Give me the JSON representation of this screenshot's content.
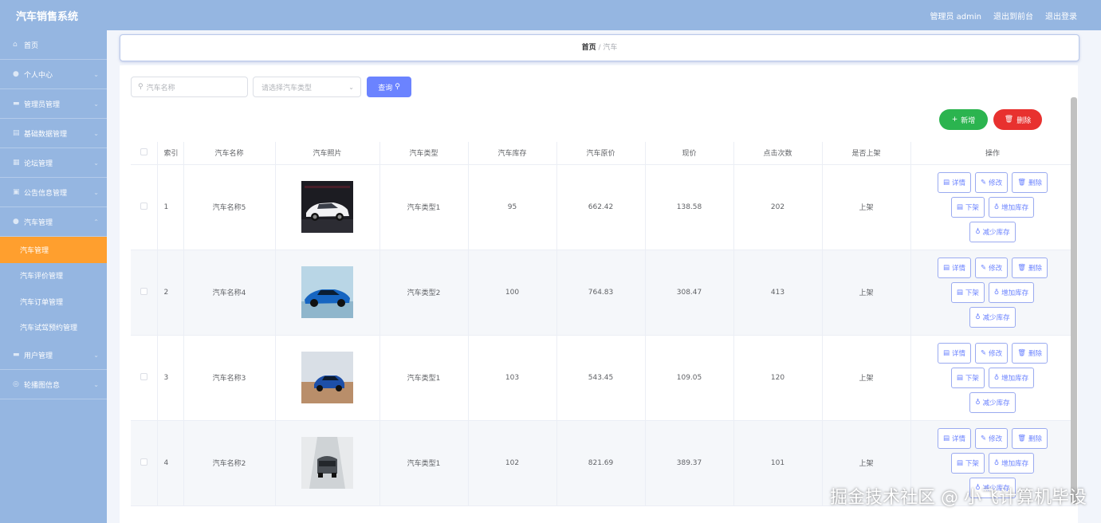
{
  "header": {
    "app_title": "汽车销售系统",
    "admin_label": "管理员 admin",
    "back_label": "退出到前台",
    "logout_label": "退出登录"
  },
  "sidebar": {
    "items": [
      {
        "icon": "home-icon",
        "label": "首页"
      },
      {
        "icon": "user-icon",
        "label": "个人中心"
      },
      {
        "icon": "manager-icon",
        "label": "管理员管理"
      },
      {
        "icon": "database-icon",
        "label": "基础数据管理"
      },
      {
        "icon": "forum-icon",
        "label": "论坛管理"
      },
      {
        "icon": "notice-icon",
        "label": "公告信息管理"
      },
      {
        "icon": "car-icon",
        "label": "汽车管理"
      }
    ],
    "sub_items": [
      "汽车管理",
      "汽车评价管理",
      "汽车订单管理",
      "汽车试驾预约管理"
    ],
    "items_after": [
      {
        "icon": "users-icon",
        "label": "用户管理"
      },
      {
        "icon": "carousel-icon",
        "label": "轮播图信息"
      }
    ]
  },
  "breadcrumb": {
    "home": "首页",
    "sep": "/",
    "current": "汽车"
  },
  "toolbar": {
    "search_placeholder": "汽车名称",
    "select_placeholder": "请选择汽车类型",
    "search_button": "查询",
    "add_button": "新增",
    "delete_button": "删除"
  },
  "table": {
    "headers": [
      "索引",
      "汽车名称",
      "汽车照片",
      "汽车类型",
      "汽车库存",
      "汽车原价",
      "现价",
      "点击次数",
      "是否上架",
      "操作"
    ],
    "rows": [
      {
        "index": "1",
        "name": "汽车名称5",
        "type": "汽车类型1",
        "stock": "95",
        "original": "662.42",
        "price": "138.58",
        "clicks": "202",
        "status": "上架",
        "photo": "white-sedan"
      },
      {
        "index": "2",
        "name": "汽车名称4",
        "type": "汽车类型2",
        "stock": "100",
        "original": "764.83",
        "price": "308.47",
        "clicks": "413",
        "status": "上架",
        "photo": "blue-sports-car"
      },
      {
        "index": "3",
        "name": "汽车名称3",
        "type": "汽车类型1",
        "stock": "103",
        "original": "543.45",
        "price": "109.05",
        "clicks": "120",
        "status": "上架",
        "photo": "blue-suv-desert"
      },
      {
        "index": "4",
        "name": "汽车名称2",
        "type": "汽车类型1",
        "stock": "102",
        "original": "821.69",
        "price": "389.37",
        "clicks": "101",
        "status": "上架",
        "photo": "gray-suv-studio"
      }
    ],
    "actions": {
      "detail": "详情",
      "edit": "修改",
      "remove": "删除",
      "offshelf": "下架",
      "add_stock": "增加库存",
      "reduce_stock": "减少库存"
    }
  },
  "watermark": "掘金技术社区 @ 小飞计算机毕设"
}
